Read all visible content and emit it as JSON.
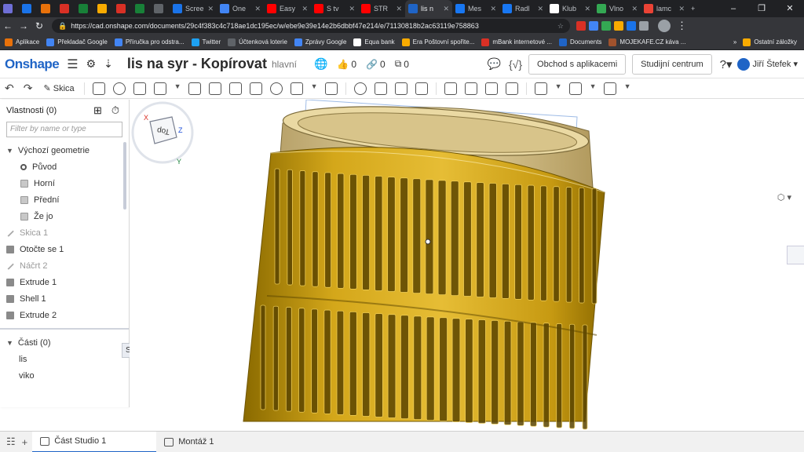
{
  "browser": {
    "tabs": [
      {
        "label": "",
        "color": "#6f6fd6"
      },
      {
        "label": "",
        "color": "#1a73e8"
      },
      {
        "label": "",
        "color": "#e8710a"
      },
      {
        "label": "",
        "color": "#d93025"
      },
      {
        "label": "",
        "color": "#188038"
      },
      {
        "label": "",
        "color": "#f9ab00"
      },
      {
        "label": "",
        "color": "#d93025"
      },
      {
        "label": "",
        "color": "#188038"
      },
      {
        "label": "",
        "color": "#5f6368"
      },
      {
        "label": "Scree",
        "color": "#1a73e8"
      },
      {
        "label": "One",
        "color": "#4285f4"
      },
      {
        "label": "Easy",
        "color": "#ff0000"
      },
      {
        "label": "S tv",
        "color": "#ff0000"
      },
      {
        "label": "STR",
        "color": "#ff0000"
      },
      {
        "label": "lis n",
        "color": "#1f64c6",
        "active": true
      },
      {
        "label": "Mes",
        "color": "#1877f2"
      },
      {
        "label": "Radl",
        "color": "#1877f2"
      },
      {
        "label": "Klub",
        "color": "#ffffff"
      },
      {
        "label": "Vlno",
        "color": "#34a853"
      },
      {
        "label": "lamc",
        "color": "#ea4335"
      }
    ],
    "new_tab": "+",
    "window_controls": [
      "–",
      "❐",
      "✕"
    ],
    "url": "https://cad.onshape.com/documents/29c4f383c4c718ae1dc195ec/w/ebe9e39e14e2b6dbbf47e214/e/71130818b2ac63119e758863",
    "bookmarks": [
      {
        "label": "Aplikace",
        "color": "#e8710a"
      },
      {
        "label": "Překladač Google",
        "color": "#4285f4"
      },
      {
        "label": "Příručka pro odstra...",
        "color": "#4285f4"
      },
      {
        "label": "Twitter",
        "color": "#1da1f2"
      },
      {
        "label": "Účtenková loterie",
        "color": "#5f6368"
      },
      {
        "label": "Zprávy Google",
        "color": "#4285f4"
      },
      {
        "label": "Equa bank",
        "color": "#ffffff"
      },
      {
        "label": "Era Poštovní spořite...",
        "color": "#f9ab00"
      },
      {
        "label": "mBank internetové ...",
        "color": "#d93025"
      },
      {
        "label": "Documents",
        "color": "#1f64c6"
      },
      {
        "label": "MOJEKAFE.CZ káva ...",
        "color": "#a0522d"
      }
    ],
    "bookmarks_more": "»",
    "other_bookmarks": "Ostatní záložky"
  },
  "app": {
    "logo": "Onshape",
    "doc_title": "lis na syr - Kopírovat",
    "branch": "hlavní",
    "likes": "0",
    "links": "0",
    "copies": "0",
    "app_store": "Obchod s aplikacemi",
    "learning_center": "Studijní centrum",
    "user": "Jiří Štefek",
    "accent": "#1f64c6"
  },
  "toolbar": {
    "sketch_label": "Skica"
  },
  "panel": {
    "title": "Vlastnosti (0)",
    "filter_placeholder": "Filter by name or type",
    "default_geometry": "Výchozí geometrie",
    "items_geometry": [
      {
        "label": "Původ",
        "icon": "origin-icon"
      },
      {
        "label": "Horní",
        "icon": "plane-icon"
      },
      {
        "label": "Přední",
        "icon": "plane-icon"
      },
      {
        "label": "Že jo",
        "icon": "plane-icon"
      }
    ],
    "features": [
      {
        "label": "Skica 1",
        "icon": "sketch-icon",
        "dim": true
      },
      {
        "label": "Otočte se 1",
        "icon": "revolve-icon",
        "dim": false
      },
      {
        "label": "Náčrt 2",
        "icon": "sketch-icon",
        "dim": true
      },
      {
        "label": "Extrude 1",
        "icon": "extrude-icon",
        "dim": false
      },
      {
        "label": "Shell 1",
        "icon": "shell-icon",
        "dim": false
      },
      {
        "label": "Extrude 2",
        "icon": "extrude-icon",
        "dim": false
      }
    ],
    "parts_title": "Části (0)",
    "parts": [
      "lis",
      "viko"
    ],
    "tooltip": "Skrýt lis"
  },
  "viewcube": {
    "face_label": "Top",
    "axis_x": "X",
    "axis_y": "Y",
    "axis_z": "Z"
  },
  "bottom_tabs": [
    {
      "label": "Část Studio 1",
      "active": true
    },
    {
      "label": "Montáž 1",
      "active": false
    }
  ]
}
